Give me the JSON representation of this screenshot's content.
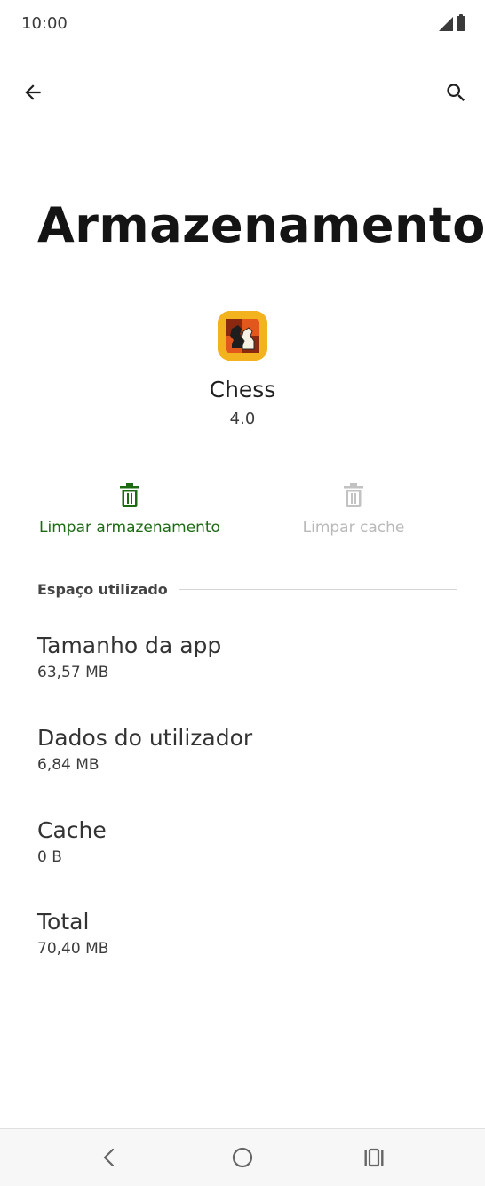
{
  "status_bar": {
    "time": "10:00"
  },
  "app_bar": {
    "back_icon": "arrow-back-icon",
    "search_icon": "search-icon"
  },
  "page": {
    "title": "Armazenamento"
  },
  "app": {
    "name": "Chess",
    "version": "4.0",
    "icon": "chess-app-icon"
  },
  "actions": {
    "clear_storage": {
      "label": "Limpar armazenamento",
      "icon": "trash-icon",
      "color": "#1c6b12",
      "enabled": true
    },
    "clear_cache": {
      "label": "Limpar cache",
      "icon": "trash-icon",
      "color": "#b9b9b9",
      "enabled": false
    }
  },
  "section": {
    "title": "Espaço utilizado",
    "items": [
      {
        "name": "Tamanho da app",
        "value": "63,57 MB"
      },
      {
        "name": "Dados do utilizador",
        "value": "6,84 MB"
      },
      {
        "name": "Cache",
        "value": "0 B"
      },
      {
        "name": "Total",
        "value": "70,40 MB"
      }
    ]
  },
  "nav_bar": {
    "back_icon": "nav-back-icon",
    "home_icon": "nav-home-icon",
    "recents_icon": "nav-recents-icon"
  }
}
